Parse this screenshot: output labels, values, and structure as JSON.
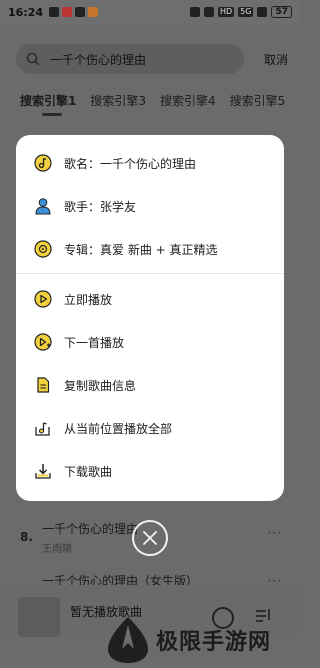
{
  "status_bar": {
    "time": "16:24",
    "battery": "57"
  },
  "search": {
    "query": "一千个伤心的理由",
    "cancel": "取消"
  },
  "tabs": [
    "搜索引擎1",
    "搜索引擎3",
    "搜索引擎4",
    "搜索引擎5"
  ],
  "background_list": [
    {
      "num": "8.",
      "title": "一千个伤心的理由",
      "artist": "王雨曦",
      "more": "···"
    },
    {
      "num": "",
      "title": "一千个伤心的理由（女生版）",
      "artist": "",
      "more": "···"
    }
  ],
  "sheet": {
    "info": [
      {
        "icon": "music-note-icon",
        "label": "歌名：一千个伤心的理由"
      },
      {
        "icon": "singer-icon",
        "label": "歌手：张学友"
      },
      {
        "icon": "album-icon",
        "label": "专辑：真爱 新曲 + 真正精选"
      }
    ],
    "actions": [
      {
        "icon": "play-now-icon",
        "label": "立即播放"
      },
      {
        "icon": "play-next-icon",
        "label": "下一首播放"
      },
      {
        "icon": "copy-info-icon",
        "label": "复制歌曲信息"
      },
      {
        "icon": "play-from-here-icon",
        "label": "从当前位置播放全部"
      },
      {
        "icon": "download-icon",
        "label": "下载歌曲"
      }
    ]
  },
  "player": {
    "title": "暂无播放歌曲"
  },
  "watermark": {
    "text": "极限手游网"
  },
  "colors": {
    "accent_yellow": "#f2d23c",
    "accent_blue": "#3a8fd8",
    "sheet_bg": "#ffffff",
    "overlay": "#6b6b6b"
  }
}
